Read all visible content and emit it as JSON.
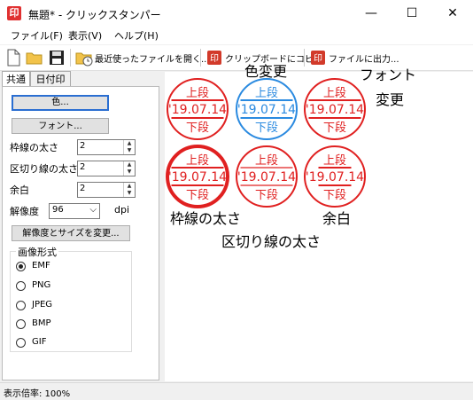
{
  "window": {
    "title": "無題* - クリックスタンパー",
    "app_icon": "印",
    "minimize_icon": "—",
    "maximize_icon": "☐",
    "close_icon": "✕"
  },
  "menu": [
    "ファイル(F)",
    "表示(V)",
    "ヘルプ(H)"
  ],
  "toolbar": {
    "recent_label": "最近使ったファイルを開く...",
    "clipboard_label": "クリップボードにコピー",
    "export_label": "ファイルに出力..."
  },
  "tabs": [
    "共通",
    "日付印"
  ],
  "panel": {
    "color_button": "色...",
    "font_button": "フォント...",
    "border_width_label": "枠線の太さ",
    "border_width_value": "2",
    "divider_width_label": "区切り線の太さ",
    "divider_width_value": "2",
    "margin_label": "余白",
    "margin_value": "2",
    "resolution_label": "解像度",
    "resolution_value": "96",
    "resolution_unit": "dpi",
    "resize_button": "解像度とサイズを変更...",
    "image_format_title": "画像形式",
    "formats": [
      "EMF",
      "PNG",
      "JPEG",
      "BMP",
      "GIF"
    ],
    "selected_format": "EMF"
  },
  "stamps": [
    {
      "top": "上段",
      "date": "'19.07.14",
      "bottom": "下段",
      "color": "#e02020"
    },
    {
      "top": "上段",
      "date": "'19.07.14",
      "bottom": "下段",
      "color": "#2a8ae0"
    },
    {
      "top": "上段",
      "date": "'19.07.14",
      "bottom": "下段",
      "color": "#e02020"
    },
    {
      "top": "上段",
      "date": "'19.07.14",
      "bottom": "下段",
      "color": "#e02020"
    },
    {
      "top": "上段",
      "date": "'19.07.14",
      "bottom": "下段",
      "color": "#e02020"
    },
    {
      "top": "上段",
      "date": "'19.07.14",
      "bottom": "下段",
      "color": "#e02020"
    }
  ],
  "annotations": {
    "color_change": "色変更",
    "font_change_1": "フォント",
    "font_change_2": "変更",
    "border_thickness": "枠線の太さ",
    "divider_thickness": "区切り線の太さ",
    "margin": "余白"
  },
  "status": "表示倍率: 100%"
}
